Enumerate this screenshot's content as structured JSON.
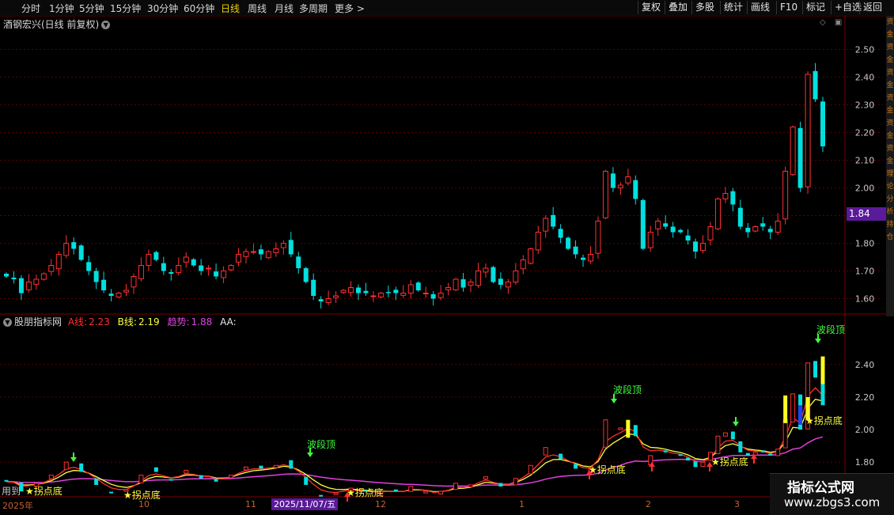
{
  "topbar": {
    "timeframes": [
      "分时",
      "1分钟",
      "5分钟",
      "15分钟",
      "30分钟",
      "60分钟",
      "日线",
      "周线",
      "月线",
      "多周期",
      "更多 >"
    ],
    "active_timeframe": "日线",
    "buttons": [
      "复权",
      "叠加",
      "多股",
      "统计",
      "画线",
      "F10",
      "标记",
      "+自选",
      "返回"
    ]
  },
  "main_chart": {
    "title": "酒钢宏兴(日线 前复权)",
    "y_ticks": [
      "2.50",
      "2.40",
      "2.30",
      "2.20",
      "2.10",
      "2.00",
      "1.90",
      "1.80",
      "1.70",
      "1.60"
    ],
    "current_price": "1.84"
  },
  "indicator": {
    "name": "股朋指标网",
    "a_label": "A线:",
    "a_value": "2.23",
    "b_label": "B线:",
    "b_value": "2.19",
    "trend_label": "趋势:",
    "trend_value": "1.88",
    "aa_label": "AA:",
    "y_ticks": [
      "2.40",
      "2.20",
      "2.00",
      "1.80"
    ],
    "signals": {
      "top": "波段顶",
      "bottom": "拐点底",
      "bottom_star": "★拐点底",
      "used_partial": "用到"
    }
  },
  "x_axis": {
    "labels": [
      "2025年",
      "10",
      "11",
      "2025/11/07/五",
      "12",
      "1",
      "2",
      "3"
    ]
  },
  "right_strip": [
    "资",
    "金",
    "资",
    "金",
    "资",
    "金",
    "资",
    "金",
    "资",
    "金",
    "资",
    "金",
    "理",
    "论",
    "分",
    "析",
    "持",
    "仓"
  ],
  "watermark": {
    "line1": "指标公式网",
    "line2": "www.zbgs3.com"
  },
  "colors": {
    "up": "#ff3030",
    "down": "#00e0e0",
    "grid": "#5a0000",
    "line_a": "#ff3030",
    "line_b": "#ffff40",
    "trend": "#e040e0",
    "signal_green": "#40ff40",
    "accent_purple": "#5a1a9a"
  },
  "chart_data": {
    "type": "candlestick",
    "price_range": [
      1.55,
      2.55
    ],
    "closes": [
      1.68,
      1.67,
      1.62,
      1.66,
      1.67,
      1.69,
      1.72,
      1.76,
      1.8,
      1.78,
      1.74,
      1.7,
      1.66,
      1.63,
      1.61,
      1.62,
      1.63,
      1.68,
      1.72,
      1.76,
      1.74,
      1.7,
      1.69,
      1.72,
      1.75,
      1.72,
      1.7,
      1.71,
      1.68,
      1.7,
      1.72,
      1.76,
      1.77,
      1.77,
      1.76,
      1.77,
      1.78,
      1.8,
      1.76,
      1.71,
      1.66,
      1.61,
      1.59,
      1.6,
      1.61,
      1.63,
      1.64,
      1.62,
      1.62,
      1.61,
      1.62,
      1.62,
      1.62,
      1.62,
      1.65,
      1.63,
      1.62,
      1.6,
      1.62,
      1.64,
      1.67,
      1.64,
      1.66,
      1.7,
      1.71,
      1.66,
      1.65,
      1.66,
      1.7,
      1.74,
      1.78,
      1.84,
      1.89,
      1.86,
      1.82,
      1.78,
      1.76,
      1.74,
      1.76,
      1.88,
      2.06,
      2.0,
      2.01,
      2.04,
      1.96,
      1.78,
      1.84,
      1.88,
      1.86,
      1.84,
      1.84,
      1.81,
      1.77,
      1.8,
      1.86,
      1.96,
      1.98,
      1.94,
      1.86,
      1.84,
      1.86,
      1.86,
      1.84,
      1.88,
      2.06,
      2.22,
      2.0,
      2.41,
      2.32,
      2.15
    ],
    "ma_a_recent": 2.23,
    "ma_b_recent": 2.19,
    "trend_recent": 1.88
  }
}
